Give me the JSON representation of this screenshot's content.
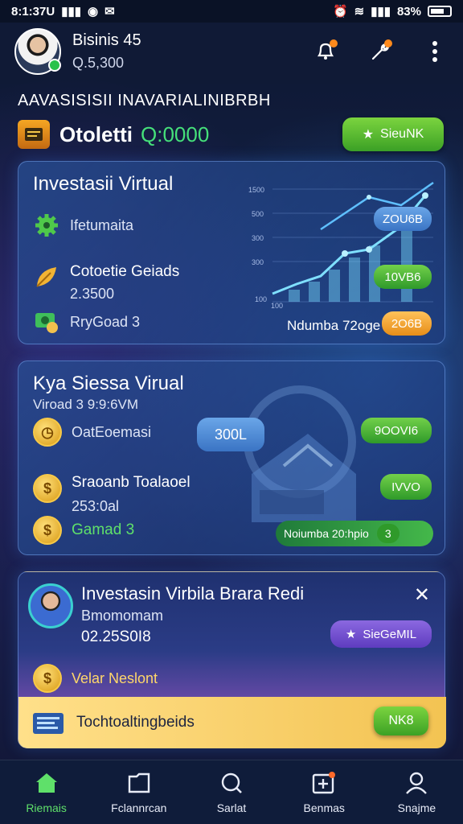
{
  "status_bar": {
    "time": "8:1:37U",
    "battery_percent": "83%"
  },
  "header": {
    "user_name": "Bisinis 45",
    "user_balance": "Q.5,300"
  },
  "heading": "AAVASISISII INAVARIALINIBRBH",
  "balance": {
    "label": "Otoletti",
    "value": "Q:0000",
    "action_label": "SieuNK"
  },
  "card1": {
    "title": "Investasii Virtual",
    "rows": [
      {
        "label": "Ifetumaita"
      },
      {
        "label": "Cotoetie Geiads",
        "value": "2.3500"
      },
      {
        "label": "RryGoad 3"
      }
    ],
    "chart_ticks": [
      "1500",
      "500",
      "300",
      "300",
      "100"
    ],
    "chart_x_first": "100",
    "chart_caption": "Ndumba 72oge",
    "pills": [
      "ZOU6B",
      "10VB6",
      "2O6B"
    ]
  },
  "card2": {
    "title": "Kya Siessa Virual",
    "subtitle": "Viroad 3 9:9:6VM",
    "rows": [
      {
        "label": "OatEoemasi"
      },
      {
        "label": "Sraoanb Toalaoel",
        "value": "253:0al"
      },
      {
        "label": "Gamad 3"
      }
    ],
    "center_pill": "300L",
    "pills": [
      "9OOVI6",
      "IVVO"
    ],
    "footer_text": "Noiumba 20:hpio",
    "footer_pill": "3"
  },
  "card3": {
    "title": "Investasin Virbila Brara Redi",
    "subtitle": "Bmomomam",
    "amount": "02.25S0I8",
    "action_label": "SieGeMIL",
    "gold_row_label": "Velar Neslont",
    "banner_label": "Tochtoaltingbeids",
    "banner_button": "NK8"
  },
  "bottom_nav": [
    {
      "label": "Riemais",
      "icon": "home-icon"
    },
    {
      "label": "Fclannrcan",
      "icon": "folder-icon"
    },
    {
      "label": "Sarlat",
      "icon": "search-icon"
    },
    {
      "label": "Benmas",
      "icon": "calendar-icon"
    },
    {
      "label": "Snajme",
      "icon": "user-icon"
    }
  ],
  "colors": {
    "accent_green": "#45e07a",
    "card_border": "#82b4ff",
    "gold": "#f7c948"
  }
}
